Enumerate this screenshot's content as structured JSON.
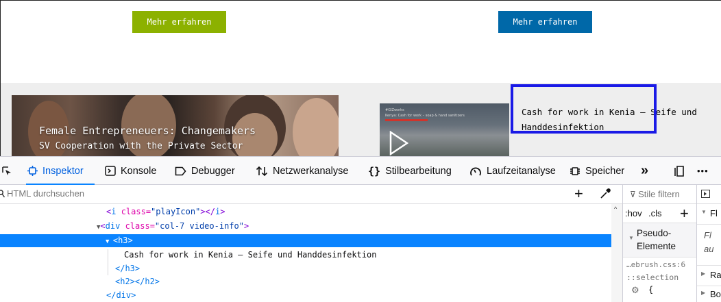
{
  "page": {
    "cta_left": "Mehr erfahren",
    "cta_right": "Mehr erfahren",
    "video_left_title": "Female Entrepreneuers: Changemakers",
    "video_left_subtitle": "SV Cooperation with the Private Sector",
    "video_right_tag": "#GIZworks",
    "video_right_caption": "Kenya: Cash for work – soap & hand sanitizers",
    "video_info_heading": "Cash for work in Kenia – Seife und Handdesinfektion",
    "colors": {
      "cta_left_bg": "#8cb100",
      "cta_right_bg": "#0068a8",
      "highlight": "#1a1ae6"
    }
  },
  "devtools": {
    "tabs": [
      {
        "label": "Inspektor",
        "icon": "inspector-icon",
        "active": true
      },
      {
        "label": "Konsole",
        "icon": "console-icon"
      },
      {
        "label": "Debugger",
        "icon": "debugger-icon"
      },
      {
        "label": "Netzwerkanalyse",
        "icon": "network-icon"
      },
      {
        "label": "Stilbearbeitung",
        "icon": "style-editor-icon"
      },
      {
        "label": "Laufzeitanalyse",
        "icon": "performance-icon"
      },
      {
        "label": "Speicher",
        "icon": "storage-icon"
      }
    ],
    "overflow": "»",
    "more": "•••",
    "search_placeholder": "HTML durchsuchen",
    "markup": {
      "l1_pre": "<",
      "l1_tag": "i",
      "l1_attr": " class=",
      "l1_val": "\"playIcon\"",
      "l1_post": "></",
      "l1_tag2": "i",
      "l1_end": ">",
      "l2_pre": "<",
      "l2_tag": "div",
      "l2_attr": " class=",
      "l2_val": "\"col-7 video-info\"",
      "l2_end": ">",
      "l3": "<h3>",
      "l4": "Cash for work in Kenia – Seife und Handdesinfektion",
      "l5": "</h3>",
      "l6": "<h2></h2>",
      "l7": "</div>"
    },
    "rules": {
      "filter_placeholder": "Stile filtern",
      "hov": ":hov",
      "cls": ".cls",
      "pseudo_label": "Pseudo-Elemente",
      "source": "…ebrush.css:6",
      "selector": "::selection",
      "brace": "{"
    },
    "layout": {
      "row1": "Fl",
      "row2a": "Fl",
      "row2b": "au",
      "row3": "Ra",
      "row4": "Bo"
    }
  }
}
